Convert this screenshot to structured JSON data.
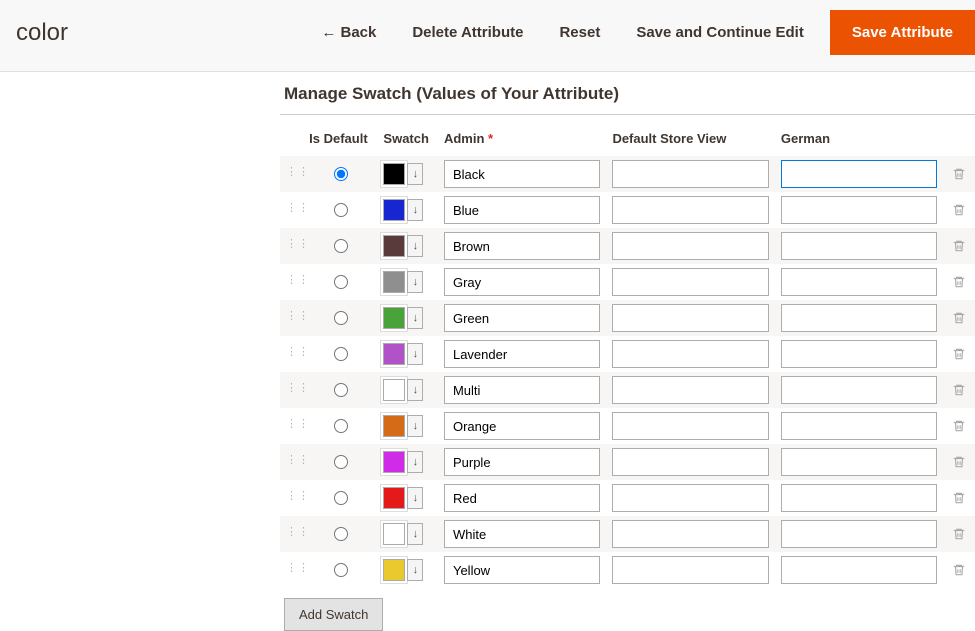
{
  "header": {
    "title": "color",
    "back_label": "Back",
    "delete_label": "Delete Attribute",
    "reset_label": "Reset",
    "save_continue_label": "Save and Continue Edit",
    "save_label": "Save Attribute"
  },
  "section_title": "Manage Swatch (Values of Your Attribute)",
  "columns": {
    "default": "Is Default",
    "swatch": "Swatch",
    "admin": "Admin",
    "default_store": "Default Store View",
    "german": "German"
  },
  "add_label": "Add Swatch",
  "rows": [
    {
      "admin": "Black",
      "color": "#000000",
      "is_default": true,
      "default_store": "",
      "german": "",
      "german_focused": true
    },
    {
      "admin": "Blue",
      "color": "#1826d1",
      "is_default": false,
      "default_store": "",
      "german": ""
    },
    {
      "admin": "Brown",
      "color": "#5a3b3b",
      "is_default": false,
      "default_store": "",
      "german": ""
    },
    {
      "admin": "Gray",
      "color": "#8f8f8f",
      "is_default": false,
      "default_store": "",
      "german": ""
    },
    {
      "admin": "Green",
      "color": "#4aa23b",
      "is_default": false,
      "default_store": "",
      "german": ""
    },
    {
      "admin": "Lavender",
      "color": "#b053c9",
      "is_default": false,
      "default_store": "",
      "german": ""
    },
    {
      "admin": "Multi",
      "color": "#ffffff",
      "is_default": false,
      "default_store": "",
      "german": ""
    },
    {
      "admin": "Orange",
      "color": "#d56b17",
      "is_default": false,
      "default_store": "",
      "german": ""
    },
    {
      "admin": "Purple",
      "color": "#d02be8",
      "is_default": false,
      "default_store": "",
      "german": ""
    },
    {
      "admin": "Red",
      "color": "#e41919",
      "is_default": false,
      "default_store": "",
      "german": ""
    },
    {
      "admin": "White",
      "color": "#ffffff",
      "is_default": false,
      "default_store": "",
      "german": ""
    },
    {
      "admin": "Yellow",
      "color": "#eac92e",
      "is_default": false,
      "default_store": "",
      "german": ""
    }
  ]
}
